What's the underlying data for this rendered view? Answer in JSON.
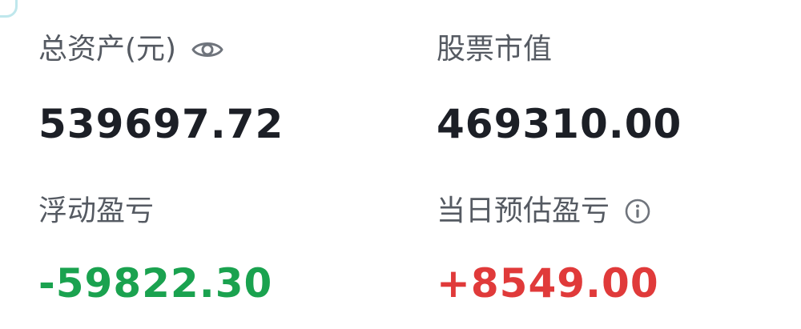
{
  "colors": {
    "label": "#555a62",
    "value_default": "#1c1f26",
    "value_negative": "#1aa24f",
    "value_positive": "#e03a3a",
    "icon": "#6f747c"
  },
  "summary": {
    "total_assets": {
      "label": "总资产(元)",
      "value": "539697.72",
      "icon": "eye-icon"
    },
    "stock_market_value": {
      "label": "股票市值",
      "value": "469310.00"
    },
    "floating_pnl": {
      "label": "浮动盈亏",
      "value": "-59822.30"
    },
    "today_estimated_pnl": {
      "label": "当日预估盈亏",
      "value": "+8549.00",
      "icon": "info-icon"
    }
  }
}
